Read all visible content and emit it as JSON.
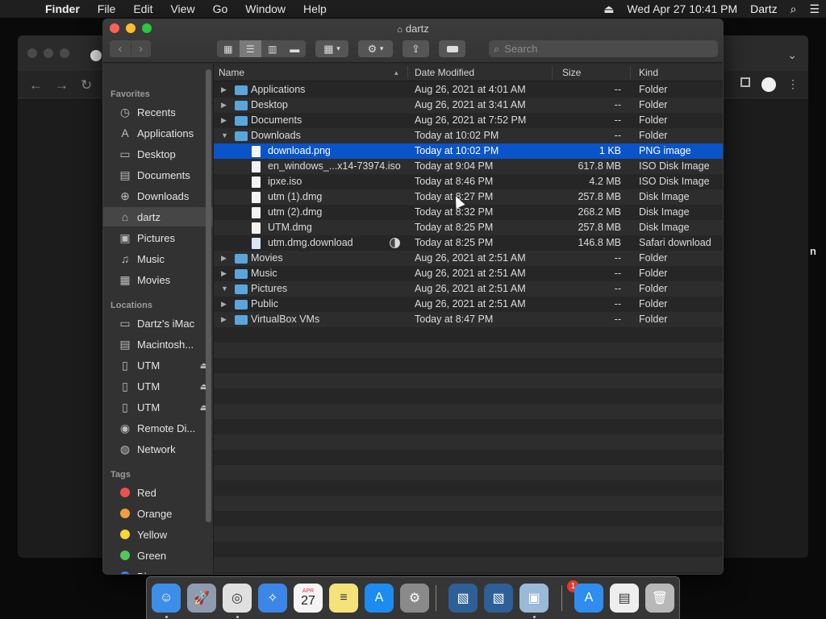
{
  "menubar": {
    "app": "Finder",
    "items": [
      "File",
      "Edit",
      "View",
      "Go",
      "Window",
      "Help"
    ],
    "clock": "Wed Apr 27  10:41 PM",
    "user": "Dartz"
  },
  "window": {
    "title": "dartz"
  },
  "search": {
    "placeholder": "Search"
  },
  "sidebar": {
    "favorites_label": "Favorites",
    "favorites": [
      {
        "label": "Recents",
        "icon": "clock-icon"
      },
      {
        "label": "Applications",
        "icon": "applications-icon"
      },
      {
        "label": "Desktop",
        "icon": "desktop-icon"
      },
      {
        "label": "Documents",
        "icon": "documents-icon"
      },
      {
        "label": "Downloads",
        "icon": "downloads-icon"
      },
      {
        "label": "dartz",
        "icon": "home-icon",
        "selected": true
      },
      {
        "label": "Pictures",
        "icon": "pictures-icon"
      },
      {
        "label": "Music",
        "icon": "music-icon"
      },
      {
        "label": "Movies",
        "icon": "movies-icon"
      }
    ],
    "locations_label": "Locations",
    "locations": [
      {
        "label": "Dartz's iMac",
        "icon": "imac-icon"
      },
      {
        "label": "Macintosh...",
        "icon": "hard-drive-icon"
      },
      {
        "label": "UTM",
        "icon": "disk-icon",
        "eject": true
      },
      {
        "label": "UTM",
        "icon": "disk-icon",
        "eject": true
      },
      {
        "label": "UTM",
        "icon": "disk-icon",
        "eject": true
      },
      {
        "label": "Remote Di...",
        "icon": "remote-disc-icon"
      },
      {
        "label": "Network",
        "icon": "network-icon"
      }
    ],
    "tags_label": "Tags",
    "tags": [
      {
        "label": "Red",
        "color": "#ec5350"
      },
      {
        "label": "Orange",
        "color": "#f0a03a"
      },
      {
        "label": "Yellow",
        "color": "#f5d53c"
      },
      {
        "label": "Green",
        "color": "#52c75a"
      },
      {
        "label": "Blue",
        "color": "#3b83f0"
      }
    ]
  },
  "columns": {
    "name": "Name",
    "date": "Date Modified",
    "size": "Size",
    "kind": "Kind"
  },
  "files": [
    {
      "name": "Applications",
      "date": "Aug 26, 2021 at 4:01 AM",
      "size": "--",
      "kind": "Folder",
      "type": "folder",
      "level": 0,
      "disclosure": "collapsed"
    },
    {
      "name": "Desktop",
      "date": "Aug 26, 2021 at 3:41 AM",
      "size": "--",
      "kind": "Folder",
      "type": "folder",
      "level": 0,
      "disclosure": "collapsed"
    },
    {
      "name": "Documents",
      "date": "Aug 26, 2021 at 7:52 PM",
      "size": "--",
      "kind": "Folder",
      "type": "folder",
      "level": 0,
      "disclosure": "collapsed"
    },
    {
      "name": "Downloads",
      "date": "Today at 10:02 PM",
      "size": "--",
      "kind": "Folder",
      "type": "folder",
      "level": 0,
      "disclosure": "expanded"
    },
    {
      "name": "download.png",
      "date": "Today at 10:02 PM",
      "size": "1 KB",
      "kind": "PNG image",
      "type": "image",
      "level": 1,
      "selected": true
    },
    {
      "name": "en_windows_...x14-73974.iso",
      "date": "Today at 9:04 PM",
      "size": "617.8 MB",
      "kind": "ISO Disk Image",
      "type": "doc",
      "level": 1
    },
    {
      "name": "ipxe.iso",
      "date": "Today at 8:46 PM",
      "size": "4.2 MB",
      "kind": "ISO Disk Image",
      "type": "doc",
      "level": 1
    },
    {
      "name": "utm (1).dmg",
      "date": "Today at 8:27 PM",
      "size": "257.8 MB",
      "kind": "Disk Image",
      "type": "doc",
      "level": 1
    },
    {
      "name": "utm (2).dmg",
      "date": "Today at 8:32 PM",
      "size": "268.2 MB",
      "kind": "Disk Image",
      "type": "doc",
      "level": 1
    },
    {
      "name": "UTM.dmg",
      "date": "Today at 8:25 PM",
      "size": "257.8 MB",
      "kind": "Disk Image",
      "type": "doc",
      "level": 1
    },
    {
      "name": "utm.dmg.download",
      "date": "Today at 8:25 PM",
      "size": "146.8 MB",
      "kind": "Safari download",
      "type": "safari",
      "level": 1,
      "progress": 0.5
    },
    {
      "name": "Movies",
      "date": "Aug 26, 2021 at 2:51 AM",
      "size": "--",
      "kind": "Folder",
      "type": "folder",
      "level": 0,
      "disclosure": "collapsed"
    },
    {
      "name": "Music",
      "date": "Aug 26, 2021 at 2:51 AM",
      "size": "--",
      "kind": "Folder",
      "type": "folder",
      "level": 0,
      "disclosure": "collapsed"
    },
    {
      "name": "Pictures",
      "date": "Aug 26, 2021 at 2:51 AM",
      "size": "--",
      "kind": "Folder",
      "type": "folder",
      "level": 0,
      "disclosure": "expanded"
    },
    {
      "name": "Public",
      "date": "Aug 26, 2021 at 2:51 AM",
      "size": "--",
      "kind": "Folder",
      "type": "folder",
      "level": 0,
      "disclosure": "collapsed"
    },
    {
      "name": "VirtualBox VMs",
      "date": "Today at 8:47 PM",
      "size": "--",
      "kind": "Folder",
      "type": "folder",
      "level": 0,
      "disclosure": "collapsed"
    }
  ],
  "dock": {
    "apps": [
      {
        "name": "finder-icon",
        "color": "#3c8ee8"
      },
      {
        "name": "launchpad-icon",
        "color": "#8f9bb0"
      },
      {
        "name": "chrome-icon",
        "color": "#e0e0e0"
      },
      {
        "name": "safari-icon",
        "color": "#3b86e8"
      },
      {
        "name": "calendar-icon",
        "color": "#f4f4f4"
      },
      {
        "name": "notes-icon",
        "color": "#f4e27a"
      },
      {
        "name": "app-store-icon",
        "color": "#1d8cf0"
      },
      {
        "name": "system-preferences-icon",
        "color": "#8a8a8a"
      },
      {
        "name": "virtualbox-icon",
        "color": "#2f5f97"
      },
      {
        "name": "virtualbox-vm-icon",
        "color": "#2f5f97"
      },
      {
        "name": "preview-icon",
        "color": "#9bb9d8"
      },
      {
        "name": "downloads-stack-icon",
        "color": "#2f8df0"
      },
      {
        "name": "documents-stack-icon",
        "color": "#eeeeee"
      },
      {
        "name": "trash-icon",
        "color": "#b8b8b8"
      }
    ],
    "calendar_month": "APR",
    "calendar_day": "27",
    "badge_count": "1"
  }
}
